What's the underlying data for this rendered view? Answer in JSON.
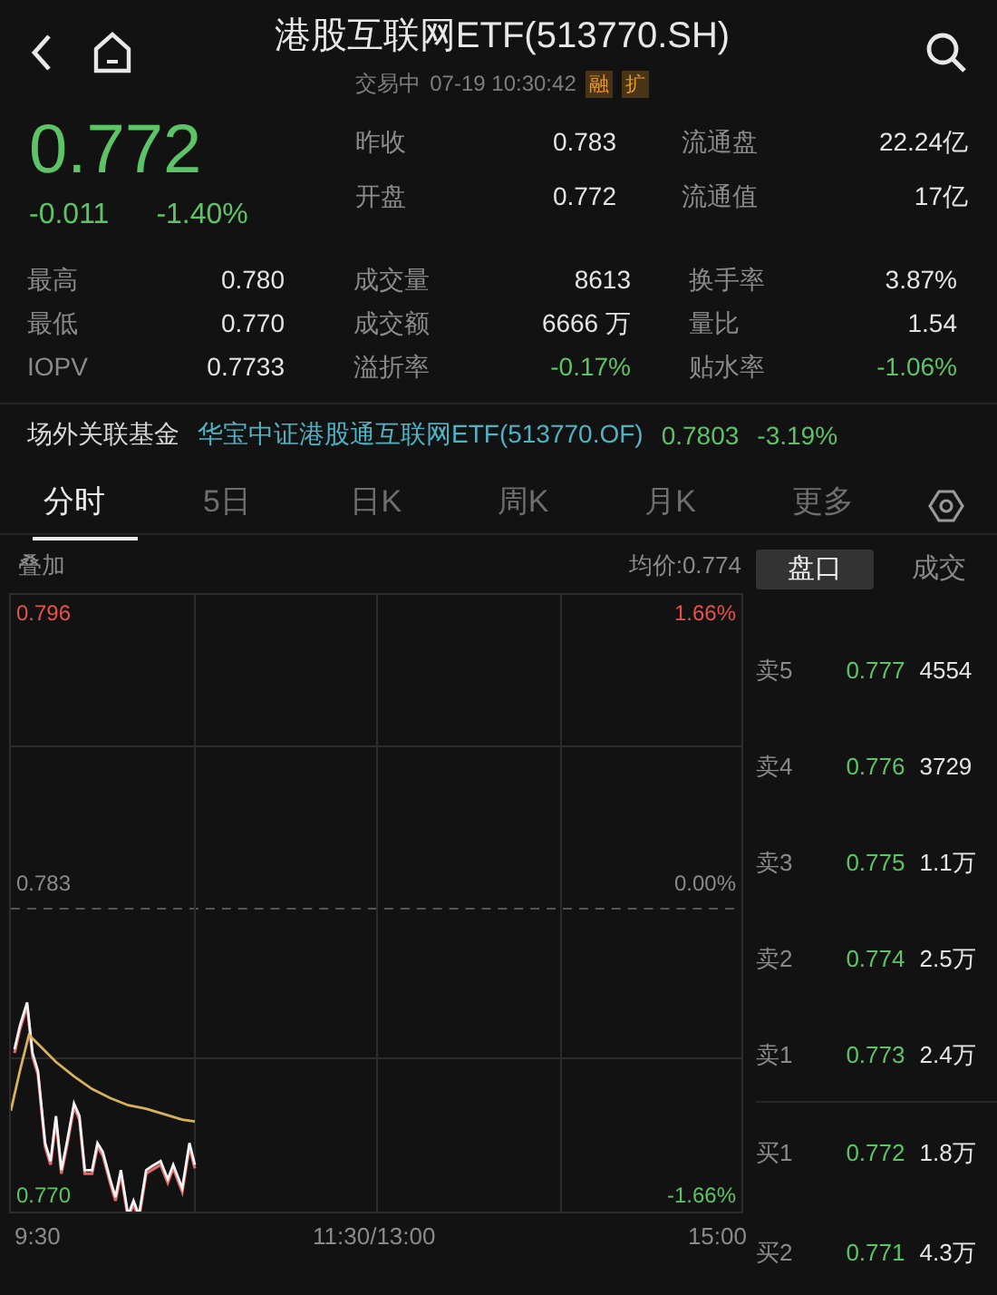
{
  "header": {
    "title": "港股互联网ETF(513770.SH)",
    "status": "交易中",
    "time": "07-19 10:30:42",
    "badges": [
      "融",
      "扩"
    ]
  },
  "quote": {
    "price": "0.772",
    "change": "-0.011",
    "change_pct": "-1.40%"
  },
  "quote_stats": [
    {
      "label": "昨收",
      "value": "0.783",
      "negative": false
    },
    {
      "label": "流通盘",
      "value": "22.24亿",
      "negative": false
    },
    {
      "label": "开盘",
      "value": "0.772",
      "negative": false
    },
    {
      "label": "流通值",
      "value": "17亿",
      "negative": false
    }
  ],
  "stats": [
    {
      "label": "最高",
      "value": "0.780",
      "negative": false
    },
    {
      "label": "成交量",
      "value": "8613",
      "negative": false
    },
    {
      "label": "换手率",
      "value": "3.87%",
      "negative": false
    },
    {
      "label": "最低",
      "value": "0.770",
      "negative": false
    },
    {
      "label": "成交额",
      "value": "6666 万",
      "negative": false
    },
    {
      "label": "量比",
      "value": "1.54",
      "negative": false
    },
    {
      "label": "IOPV",
      "value": "0.7733",
      "negative": false
    },
    {
      "label": "溢折率",
      "value": "-0.17%",
      "negative": true
    },
    {
      "label": "贴水率",
      "value": "-1.06%",
      "negative": true
    }
  ],
  "related_fund": {
    "label": "场外关联基金",
    "name": "华宝中证港股通互联网ETF(513770.OF)",
    "price": "0.7803",
    "change": "-3.19%"
  },
  "tabs": [
    {
      "label": "分时",
      "selected": true
    },
    {
      "label": "5日",
      "selected": false
    },
    {
      "label": "日K",
      "selected": false
    },
    {
      "label": "周K",
      "selected": false
    },
    {
      "label": "月K",
      "selected": false
    },
    {
      "label": "更多",
      "selected": false
    }
  ],
  "chart": {
    "overlay": "叠加",
    "average": "均价:0.774",
    "top_price": "0.796",
    "top_pct": "1.66%",
    "mid_price": "0.783",
    "mid_pct": "0.00%",
    "bottom_price": "0.770",
    "bottom_pct": "-1.66%",
    "x_labels": [
      "9:30",
      "11:30/13:00",
      "15:00"
    ]
  },
  "book_tabs": [
    {
      "label": "盘口",
      "selected": true
    },
    {
      "label": "成交",
      "selected": false
    }
  ],
  "order_book": [
    {
      "label": "卖5",
      "price": "0.777",
      "volume": "4554",
      "kind": "sell"
    },
    {
      "label": "卖4",
      "price": "0.776",
      "volume": "3729",
      "kind": "sell"
    },
    {
      "label": "卖3",
      "price": "0.775",
      "volume": "1.1万",
      "kind": "sell"
    },
    {
      "label": "卖2",
      "price": "0.774",
      "volume": "2.5万",
      "kind": "sell"
    },
    {
      "label": "卖1",
      "price": "0.773",
      "volume": "2.4万",
      "kind": "sell"
    },
    {
      "label": "买1",
      "price": "0.772",
      "volume": "1.8万",
      "kind": "buy"
    },
    {
      "label": "买2",
      "price": "0.771",
      "volume": "4.3万",
      "kind": "buy"
    }
  ]
}
